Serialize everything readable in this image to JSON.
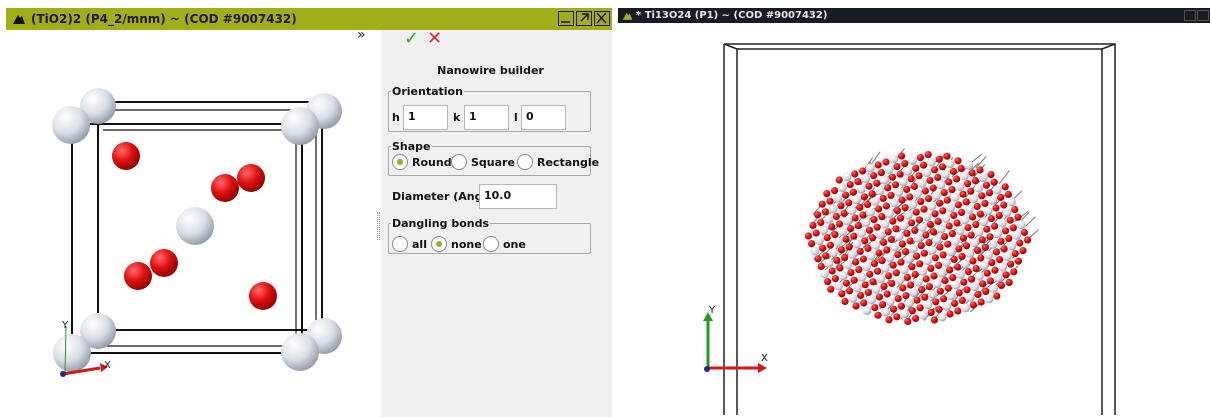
{
  "left_window": {
    "title": "(TiO2)2  (P4_2/mnm) ~ (COD #9007432)"
  },
  "right_window": {
    "title": "* Ti13O24  (P1) ~ (COD #9007432)"
  },
  "panel": {
    "title": "Nanowire builder",
    "orientation": {
      "legend": "Orientation",
      "h_label": "h",
      "h_value": "1",
      "k_label": "k",
      "k_value": "1",
      "l_label": "l",
      "l_value": "0"
    },
    "shape": {
      "legend": "Shape",
      "options": [
        "Round",
        "Square",
        "Rectangle"
      ],
      "selected": "Round"
    },
    "diameter": {
      "label": "Diameter (Ang):",
      "value": "10.0"
    },
    "dangling": {
      "legend": "Dangling bonds",
      "options": [
        "all",
        "none",
        "one"
      ],
      "selected": "none"
    }
  },
  "axes": {
    "x": "X",
    "y": "Y"
  },
  "colors": {
    "accent": "#a2ad1a",
    "oxygen": "#e01010",
    "titanium": "#e4e8ee",
    "dark_title": "#171c22"
  }
}
